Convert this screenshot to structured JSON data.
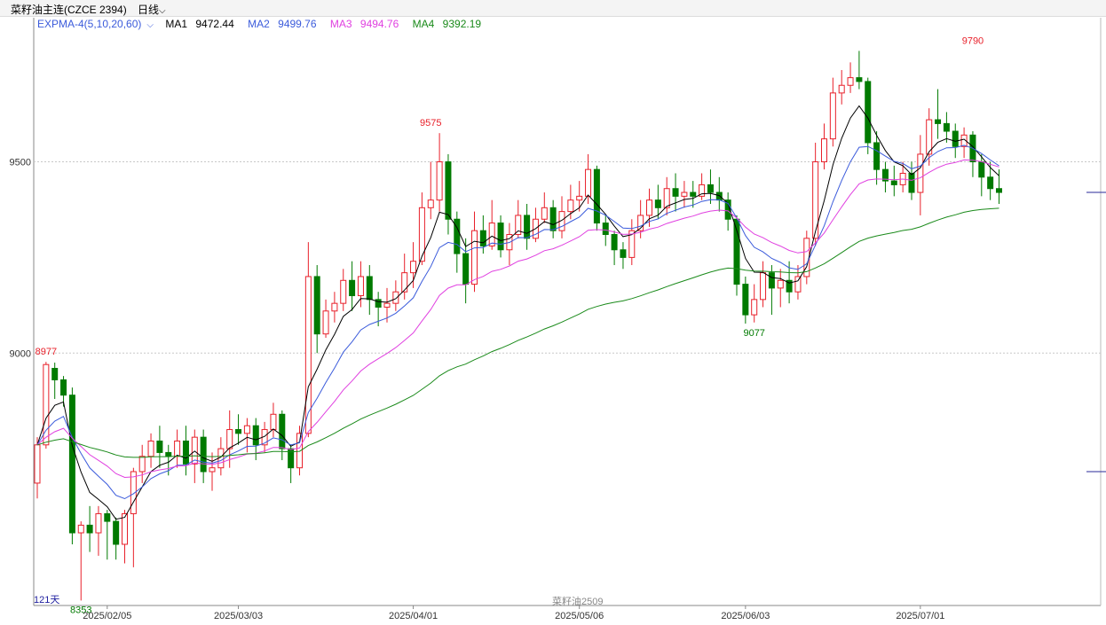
{
  "header": {
    "instrument": "菜籽油主连(CZCE 2394)",
    "period": "日线",
    "period_icon": "chevron-down-icon"
  },
  "legend": {
    "indicator": "EXPMA-4(5,10,20,60)",
    "indicator_icon": "chevron-down-icon",
    "ma1": {
      "label": "MA1",
      "value": "9472.44",
      "color": "#000000"
    },
    "ma2": {
      "label": "MA2",
      "value": "9499.76",
      "color": "#3b5bdb"
    },
    "ma3": {
      "label": "MA3",
      "value": "9494.76",
      "color": "#e040e0"
    },
    "ma4": {
      "label": "MA4",
      "value": "9392.19",
      "color": "#1a8a1a"
    }
  },
  "footer": {
    "days": "121天",
    "center_label": "菜籽油2509"
  },
  "colors": {
    "up": "#e8202a",
    "down": "#007a00",
    "grid": "#c8c8c8"
  },
  "chart_data": {
    "type": "candlestick",
    "y_ticks": [
      9000,
      9500
    ],
    "ylim": [
      8340,
      9835
    ],
    "x_labels": [
      {
        "label": "2025/02/05",
        "index": 8
      },
      {
        "label": "2025/03/03",
        "index": 23
      },
      {
        "label": "2025/04/01",
        "index": 43
      },
      {
        "label": "2025/05/06",
        "index": 62
      },
      {
        "label": "2025/06/03",
        "index": 81
      },
      {
        "label": "2025/07/01",
        "index": 101
      }
    ],
    "annotations": [
      {
        "text": "8977",
        "index": 1,
        "price": 8977,
        "kind": "high"
      },
      {
        "text": "8353",
        "index": 5,
        "price": 8353,
        "kind": "low"
      },
      {
        "text": "9575",
        "index": 45,
        "price": 9575,
        "kind": "high"
      },
      {
        "text": "9077",
        "index": 82,
        "price": 9077,
        "kind": "low"
      },
      {
        "text": "9790",
        "index": 107,
        "price": 9790,
        "kind": "high"
      }
    ],
    "candles": [
      [
        8660,
        8760,
        8620,
        8780
      ],
      [
        8760,
        8970,
        8750,
        8977
      ],
      [
        8960,
        8930,
        8880,
        8975
      ],
      [
        8930,
        8890,
        8860,
        8940
      ],
      [
        8890,
        8530,
        8500,
        8910
      ],
      [
        8530,
        8550,
        8353,
        8560
      ],
      [
        8550,
        8530,
        8480,
        8600
      ],
      [
        8530,
        8580,
        8470,
        8600
      ],
      [
        8580,
        8560,
        8460,
        8590
      ],
      [
        8560,
        8500,
        8460,
        8570
      ],
      [
        8500,
        8580,
        8450,
        8590
      ],
      [
        8580,
        8690,
        8440,
        8700
      ],
      [
        8690,
        8730,
        8660,
        8760
      ],
      [
        8730,
        8770,
        8700,
        8790
      ],
      [
        8770,
        8740,
        8700,
        8810
      ],
      [
        8740,
        8730,
        8680,
        8760
      ],
      [
        8730,
        8770,
        8700,
        8800
      ],
      [
        8770,
        8710,
        8680,
        8810
      ],
      [
        8710,
        8780,
        8660,
        8800
      ],
      [
        8780,
        8690,
        8660,
        8800
      ],
      [
        8690,
        8700,
        8640,
        8740
      ],
      [
        8700,
        8750,
        8680,
        8780
      ],
      [
        8750,
        8800,
        8700,
        8850
      ],
      [
        8800,
        8790,
        8760,
        8840
      ],
      [
        8790,
        8810,
        8740,
        8830
      ],
      [
        8810,
        8760,
        8720,
        8830
      ],
      [
        8760,
        8800,
        8740,
        8820
      ],
      [
        8800,
        8840,
        8780,
        8870
      ],
      [
        8840,
        8750,
        8720,
        8850
      ],
      [
        8750,
        8700,
        8660,
        8760
      ],
      [
        8700,
        8790,
        8680,
        8810
      ],
      [
        8790,
        9200,
        8780,
        9290
      ],
      [
        9200,
        9050,
        9000,
        9230
      ],
      [
        9050,
        9110,
        9040,
        9140
      ],
      [
        9110,
        9130,
        9080,
        9160
      ],
      [
        9130,
        9190,
        9110,
        9220
      ],
      [
        9190,
        9150,
        9110,
        9240
      ],
      [
        9150,
        9200,
        9120,
        9240
      ],
      [
        9200,
        9140,
        9100,
        9230
      ],
      [
        9140,
        9120,
        9070,
        9160
      ],
      [
        9120,
        9130,
        9080,
        9170
      ],
      [
        9130,
        9160,
        9110,
        9190
      ],
      [
        9160,
        9210,
        9140,
        9260
      ],
      [
        9210,
        9240,
        9170,
        9290
      ],
      [
        9240,
        9380,
        9230,
        9420
      ],
      [
        9380,
        9400,
        9350,
        9500
      ],
      [
        9400,
        9500,
        9370,
        9575
      ],
      [
        9500,
        9350,
        9310,
        9520
      ],
      [
        9350,
        9260,
        9210,
        9370
      ],
      [
        9260,
        9180,
        9130,
        9300
      ],
      [
        9180,
        9320,
        9160,
        9370
      ],
      [
        9320,
        9280,
        9260,
        9360
      ],
      [
        9280,
        9340,
        9270,
        9400
      ],
      [
        9340,
        9270,
        9250,
        9360
      ],
      [
        9270,
        9310,
        9230,
        9340
      ],
      [
        9310,
        9360,
        9300,
        9400
      ],
      [
        9360,
        9300,
        9270,
        9390
      ],
      [
        9300,
        9350,
        9290,
        9380
      ],
      [
        9350,
        9380,
        9340,
        9420
      ],
      [
        9380,
        9320,
        9300,
        9400
      ],
      [
        9320,
        9370,
        9300,
        9410
      ],
      [
        9370,
        9400,
        9350,
        9440
      ],
      [
        9400,
        9410,
        9370,
        9450
      ],
      [
        9410,
        9480,
        9390,
        9520
      ],
      [
        9480,
        9340,
        9320,
        9490
      ],
      [
        9340,
        9310,
        9280,
        9360
      ],
      [
        9310,
        9270,
        9230,
        9320
      ],
      [
        9270,
        9250,
        9220,
        9290
      ],
      [
        9250,
        9320,
        9230,
        9350
      ],
      [
        9320,
        9360,
        9300,
        9400
      ],
      [
        9360,
        9400,
        9330,
        9430
      ],
      [
        9400,
        9380,
        9350,
        9440
      ],
      [
        9380,
        9430,
        9360,
        9460
      ],
      [
        9430,
        9410,
        9370,
        9470
      ],
      [
        9410,
        9420,
        9380,
        9450
      ],
      [
        9420,
        9410,
        9380,
        9450
      ],
      [
        9410,
        9440,
        9400,
        9470
      ],
      [
        9440,
        9420,
        9390,
        9480
      ],
      [
        9420,
        9400,
        9370,
        9460
      ],
      [
        9400,
        9350,
        9320,
        9420
      ],
      [
        9350,
        9180,
        9150,
        9360
      ],
      [
        9180,
        9100,
        9077,
        9200
      ],
      [
        9100,
        9140,
        9080,
        9180
      ],
      [
        9140,
        9210,
        9120,
        9240
      ],
      [
        9210,
        9170,
        9100,
        9230
      ],
      [
        9170,
        9190,
        9120,
        9220
      ],
      [
        9190,
        9160,
        9130,
        9240
      ],
      [
        9160,
        9200,
        9140,
        9230
      ],
      [
        9200,
        9300,
        9180,
        9320
      ],
      [
        9300,
        9500,
        9280,
        9550
      ],
      [
        9500,
        9560,
        9480,
        9600
      ],
      [
        9560,
        9680,
        9540,
        9720
      ],
      [
        9680,
        9700,
        9650,
        9740
      ],
      [
        9700,
        9720,
        9680,
        9760
      ],
      [
        9720,
        9710,
        9690,
        9790
      ],
      [
        9710,
        9550,
        9520,
        9720
      ],
      [
        9550,
        9480,
        9440,
        9580
      ],
      [
        9480,
        9450,
        9420,
        9500
      ],
      [
        9450,
        9440,
        9410,
        9490
      ],
      [
        9440,
        9470,
        9420,
        9500
      ],
      [
        9470,
        9420,
        9400,
        9500
      ],
      [
        9420,
        9520,
        9360,
        9570
      ],
      [
        9520,
        9610,
        9490,
        9640
      ],
      [
        9610,
        9600,
        9560,
        9690
      ],
      [
        9600,
        9580,
        9550,
        9630
      ],
      [
        9580,
        9540,
        9510,
        9600
      ],
      [
        9540,
        9570,
        9510,
        9590
      ],
      [
        9570,
        9500,
        9460,
        9580
      ],
      [
        9500,
        9460,
        9410,
        9520
      ],
      [
        9460,
        9430,
        9400,
        9500
      ],
      [
        9430,
        9420,
        9390,
        9480
      ]
    ],
    "series": [
      {
        "name": "MA1",
        "period": 5
      },
      {
        "name": "MA2",
        "period": 10
      },
      {
        "name": "MA3",
        "period": 20
      },
      {
        "name": "MA4",
        "period": 60
      }
    ],
    "right_markers": [
      9420,
      8690
    ]
  }
}
